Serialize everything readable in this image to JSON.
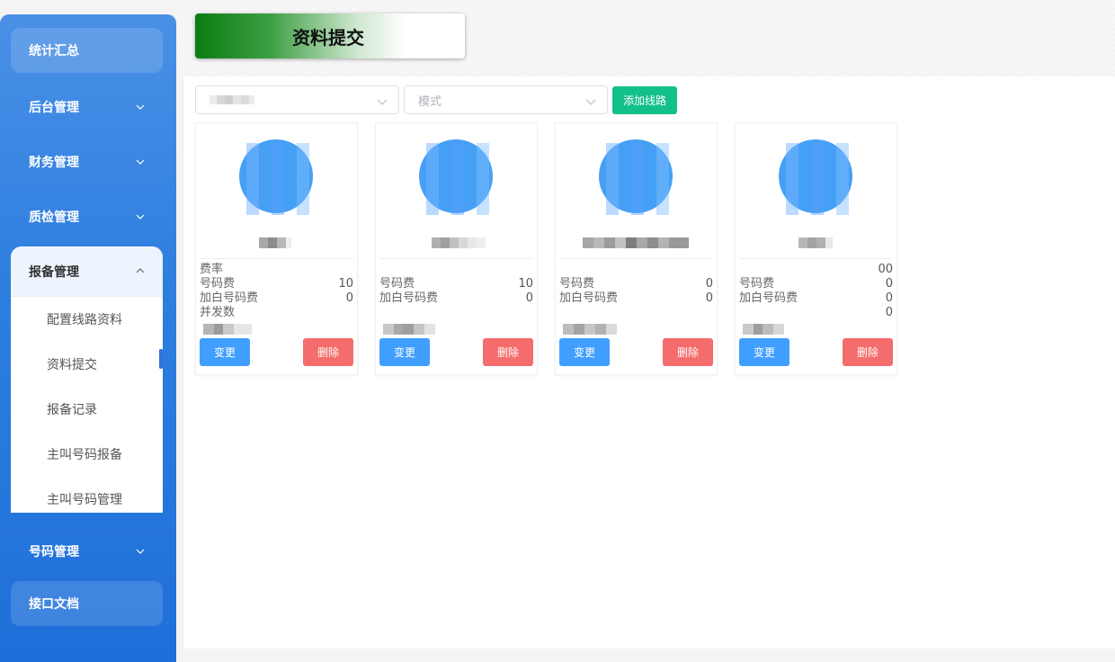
{
  "sidebar": {
    "items_top": [
      {
        "label": "统计汇总"
      },
      {
        "label": "后台管理"
      },
      {
        "label": "财务管理"
      },
      {
        "label": "质检管理"
      }
    ],
    "group": {
      "label": "报备管理",
      "sub_items": [
        {
          "label": "配置线路资料"
        },
        {
          "label": "资料提交"
        },
        {
          "label": "报备记录"
        },
        {
          "label": "主叫号码报备"
        },
        {
          "label": "主叫号码管理"
        }
      ]
    },
    "items_bottom": [
      {
        "label": "号码管理"
      },
      {
        "label": "接口文档"
      }
    ]
  },
  "header": {
    "title": "资料提交"
  },
  "toolbar": {
    "select1_value": "",
    "select2_placeholder": "模式",
    "add_button": "添加线路"
  },
  "cards": [
    {
      "rate_label": "费率",
      "rate_value": "",
      "number_fee_label": "号码费",
      "number_fee_value": "10",
      "whitelist_fee_label": "加白号码费",
      "whitelist_fee_value": "0",
      "concurrency_label": "并发数",
      "concurrency_value": "",
      "edit": "变更",
      "delete": "删除"
    },
    {
      "rate_label": "",
      "rate_value": "",
      "number_fee_label": "号码费",
      "number_fee_value": "10",
      "whitelist_fee_label": "加白号码费",
      "whitelist_fee_value": "0",
      "concurrency_label": "",
      "concurrency_value": "",
      "edit": "变更",
      "delete": "删除"
    },
    {
      "rate_label": "",
      "rate_value": "",
      "number_fee_label": "号码费",
      "number_fee_value": "0",
      "whitelist_fee_label": "加白号码费",
      "whitelist_fee_value": "0",
      "concurrency_label": "",
      "concurrency_value": "",
      "edit": "变更",
      "delete": "删除"
    },
    {
      "rate_label": "",
      "rate_value": "00",
      "number_fee_label": "号码费",
      "number_fee_value": "0",
      "whitelist_fee_label": "加白号码费",
      "whitelist_fee_value": "0",
      "concurrency_label": "",
      "concurrency_value": "0",
      "edit": "变更",
      "delete": "删除"
    }
  ],
  "colors": {
    "sidebar": "#2f7fe0",
    "accent_green": "#13c08a",
    "edit_blue": "#409eff",
    "delete_red": "#f56c6c"
  }
}
